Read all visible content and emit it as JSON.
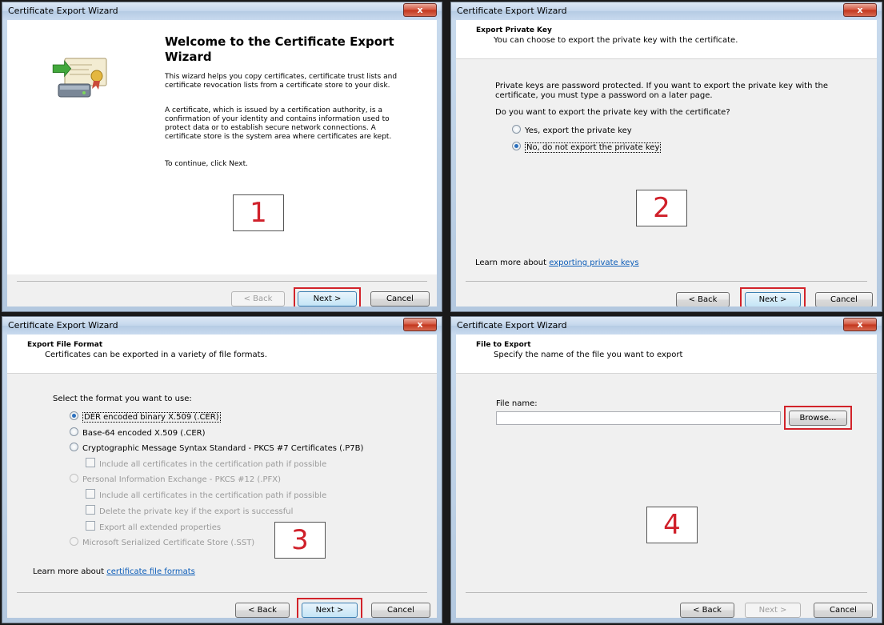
{
  "window_title": "Certificate Export Wizard",
  "close_glyph": "x",
  "buttons": {
    "back": "< Back",
    "next": "Next >",
    "cancel": "Cancel",
    "browse": "Browse..."
  },
  "panel1": {
    "heading": "Welcome to the Certificate Export Wizard",
    "para1": "This wizard helps you copy certificates, certificate trust lists and certificate revocation lists from a certificate store to your disk.",
    "para2": "A certificate, which is issued by a certification authority, is a confirmation of your identity and contains information used to protect data or to establish secure network connections. A certificate store is the system area where certificates are kept.",
    "para3": "To continue, click Next.",
    "step": "1"
  },
  "panel2": {
    "header_title": "Export Private Key",
    "header_subtitle": "You can choose to export the private key with the certificate.",
    "para1": "Private keys are password protected. If you want to export the private key with the certificate, you must type a password on a later page.",
    "question": "Do you want to export the private key with the certificate?",
    "option_yes": "Yes, export the private key",
    "option_no": "No, do not export the private key",
    "learn_prefix": "Learn more about ",
    "learn_link": "exporting private keys",
    "step": "2"
  },
  "panel3": {
    "header_title": "Export File Format",
    "header_subtitle": "Certificates can be exported in a variety of file formats.",
    "prompt": "Select the format you want to use:",
    "formats": {
      "der": "DER encoded binary X.509 (.CER)",
      "base64": "Base-64 encoded X.509 (.CER)",
      "pkcs7": "Cryptographic Message Syntax Standard - PKCS #7 Certificates (.P7B)",
      "pkcs7_include": "Include all certificates in the certification path if possible",
      "pfx": "Personal Information Exchange - PKCS #12 (.PFX)",
      "pfx_include": "Include all certificates in the certification path if possible",
      "pfx_delete": "Delete the private key if the export is successful",
      "pfx_export_all": "Export all extended properties",
      "sst": "Microsoft Serialized Certificate Store (.SST)"
    },
    "learn_prefix": "Learn more about ",
    "learn_link": "certificate file formats",
    "step": "3"
  },
  "panel4": {
    "header_title": "File to Export",
    "header_subtitle": "Specify the name of the file you want to export",
    "file_label": "File name:",
    "file_value": "",
    "step": "4"
  },
  "colors": {
    "highlight": "#d2232a",
    "link": "#0b5cb8",
    "title_bar": "#c3d6ec"
  }
}
